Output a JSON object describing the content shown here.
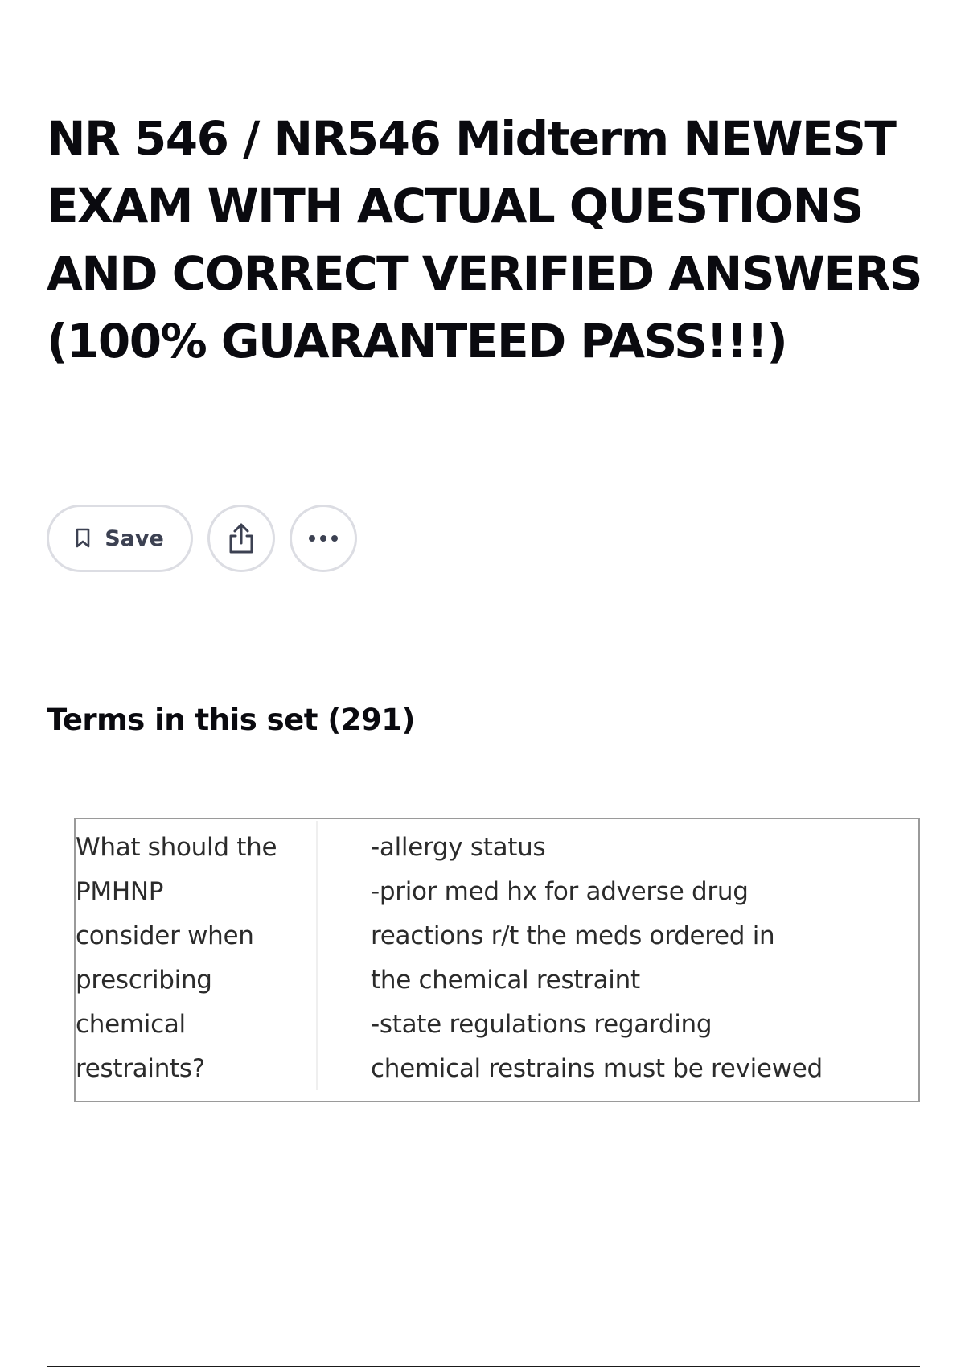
{
  "header": {
    "title": "NR 546 / NR546 Midterm NEWEST EXAM WITH ACTUAL QUESTIONS AND CORRECT VERIFIED ANSWERS (100% GUARANTEED PASS!!!)"
  },
  "actions": {
    "save_label": "Save",
    "save_icon": "bookmark-icon",
    "share_icon": "share-icon",
    "more_icon": "more-options-icon"
  },
  "terms": {
    "heading": "Terms in this set (291)",
    "items": [
      {
        "term": "What should the\nPMHNP\nconsider when\nprescribing\nchemical\nrestraints?",
        "definition": "-allergy status\n-prior med hx for adverse drug\nreactions r/t the meds ordered in\nthe chemical restraint\n-state regulations regarding\nchemical restrains must be reviewed"
      }
    ]
  },
  "colors": {
    "title": "#0a0a0f",
    "button_border": "#dcdde3",
    "button_text": "#3c4152",
    "card_border": "#9a9a9a",
    "card_text": "#2b2b2b"
  }
}
